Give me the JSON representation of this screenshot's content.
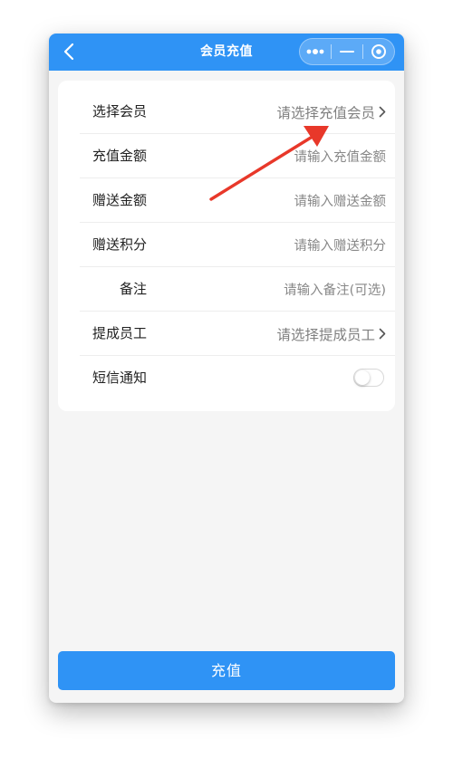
{
  "header": {
    "title": "会员充值",
    "accent_color": "#2f93f5",
    "back_icon": "chevron-left-icon",
    "capsule_icons": [
      "more-dots-icon",
      "minimize-icon",
      "close-target-icon"
    ]
  },
  "form": {
    "rows": [
      {
        "label": "选择会员",
        "value": "请选择充值会员",
        "type": "select"
      },
      {
        "label": "充值金额",
        "value": "请输入充值金额",
        "type": "input"
      },
      {
        "label": "赠送金额",
        "value": "请输入赠送金额",
        "type": "input"
      },
      {
        "label": "赠送积分",
        "value": "请输入赠送积分",
        "type": "input"
      },
      {
        "label": "备注",
        "value": "请输入备注(可选)",
        "type": "input"
      },
      {
        "label": "提成员工",
        "value": "请选择提成员工",
        "type": "select"
      },
      {
        "label": "短信通知",
        "value": false,
        "type": "toggle"
      }
    ]
  },
  "annotation": {
    "icon": "red-arrow-icon",
    "color": "#e8382a"
  },
  "footer": {
    "submit_label": "充值"
  }
}
